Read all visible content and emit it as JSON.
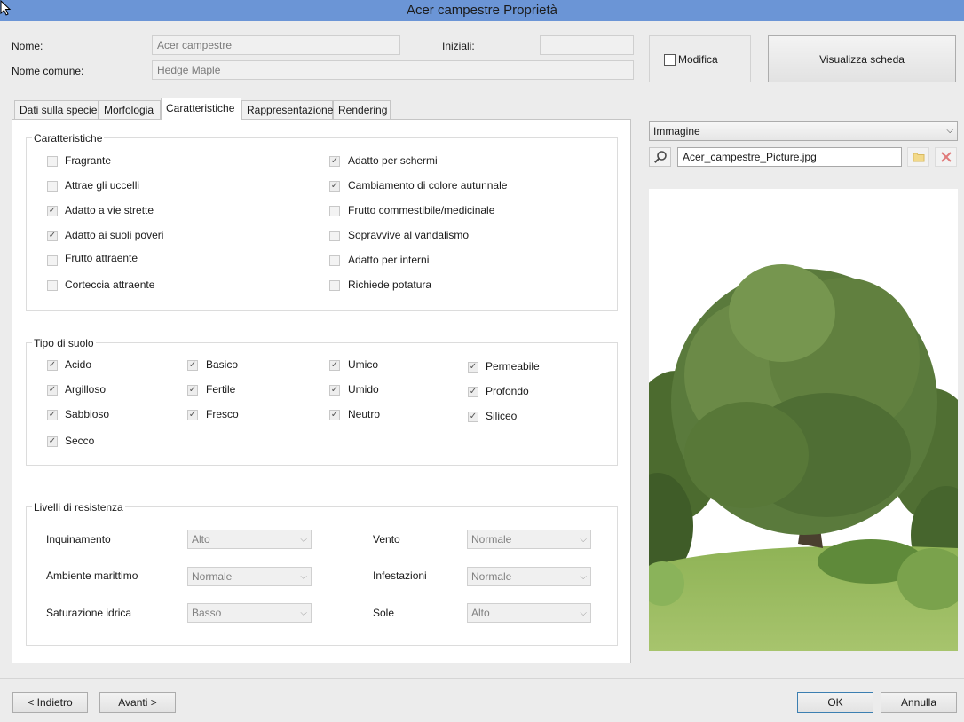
{
  "window": {
    "title": "Acer campestre Proprietà"
  },
  "header": {
    "nome_label": "Nome:",
    "nome_value": "Acer campestre",
    "iniziali_label": "Iniziali:",
    "iniziali_value": "",
    "nome_comune_label": "Nome comune:",
    "nome_comune_value": "Hedge Maple",
    "modifica_label": "Modifica",
    "modifica_checked": false,
    "visualizza_label": "Visualizza scheda"
  },
  "tabs": [
    {
      "label": "Dati sulla specie",
      "active": false
    },
    {
      "label": "Morfologia",
      "active": false
    },
    {
      "label": "Caratteristiche",
      "active": true
    },
    {
      "label": "Rappresentazione",
      "active": false
    },
    {
      "label": "Rendering",
      "active": false
    }
  ],
  "caratteristiche": {
    "title": "Caratteristiche",
    "left": [
      {
        "label": "Fragrante",
        "checked": false
      },
      {
        "label": "Attrae gli uccelli",
        "checked": false
      },
      {
        "label": "Adatto a vie strette",
        "checked": true
      },
      {
        "label": "Adatto ai suoli poveri",
        "checked": true
      },
      {
        "label": "Frutto attraente",
        "checked": false
      },
      {
        "label": "Corteccia attraente",
        "checked": false
      }
    ],
    "right": [
      {
        "label": "Adatto per schermi",
        "checked": true
      },
      {
        "label": "Cambiamento di colore autunnale",
        "checked": true
      },
      {
        "label": "Frutto commestibile/medicinale",
        "checked": false
      },
      {
        "label": "Sopravvive al vandalismo",
        "checked": false
      },
      {
        "label": "Adatto per interni",
        "checked": false
      },
      {
        "label": "Richiede potatura",
        "checked": false
      }
    ]
  },
  "suolo": {
    "title": "Tipo di suolo",
    "col1": [
      {
        "label": "Acido",
        "checked": true
      },
      {
        "label": "Argilloso",
        "checked": true
      },
      {
        "label": "Sabbioso",
        "checked": true
      },
      {
        "label": "Secco",
        "checked": true
      }
    ],
    "col2": [
      {
        "label": "Basico",
        "checked": true
      },
      {
        "label": "Fertile",
        "checked": true
      },
      {
        "label": "Fresco",
        "checked": true
      }
    ],
    "col3": [
      {
        "label": "Umico",
        "checked": true
      },
      {
        "label": "Umido",
        "checked": true
      },
      {
        "label": "Neutro",
        "checked": true
      }
    ],
    "col4": [
      {
        "label": "Permeabile",
        "checked": true
      },
      {
        "label": "Profondo",
        "checked": true
      },
      {
        "label": "Siliceo",
        "checked": true
      }
    ]
  },
  "resistenza": {
    "title": "Livelli di resistenza",
    "left": [
      {
        "label": "Inquinamento",
        "value": "Alto"
      },
      {
        "label": "Ambiente marittimo",
        "value": "Normale"
      },
      {
        "label": "Saturazione idrica",
        "value": "Basso"
      }
    ],
    "right": [
      {
        "label": "Vento",
        "value": "Normale"
      },
      {
        "label": "Infestazioni",
        "value": "Normale"
      },
      {
        "label": "Sole",
        "value": "Alto"
      }
    ]
  },
  "image_panel": {
    "type_value": "Immagine",
    "filename": "Acer_campestre_Picture.jpg",
    "icons": [
      "magnifier-icon",
      "folder-icon",
      "delete-icon"
    ]
  },
  "footer": {
    "back_label": "< Indietro",
    "next_label": "Avanti >",
    "ok_label": "OK",
    "cancel_label": "Annulla"
  },
  "colors": {
    "titlebar": "#6b95d6",
    "ok_border": "#3c7fb1"
  }
}
